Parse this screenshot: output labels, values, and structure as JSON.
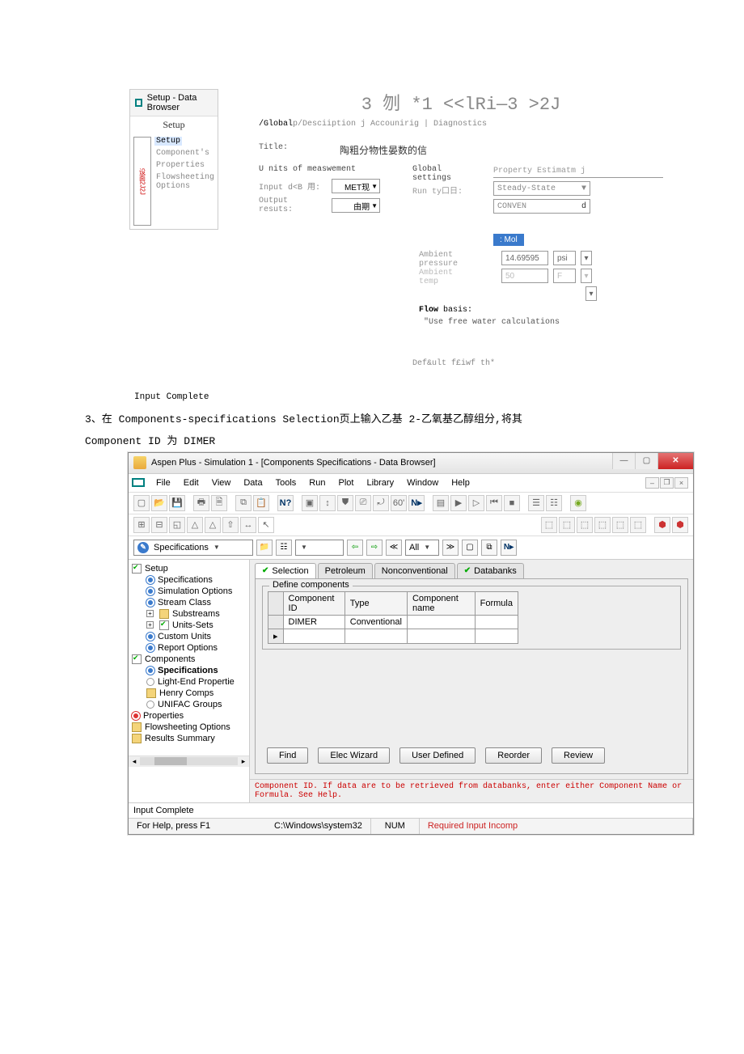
{
  "mini": {
    "title": "Setup - Data Browser",
    "subtitle": "Setup",
    "left_label": "设面2J2J",
    "items": [
      "Setup",
      "Component's",
      "Properties",
      "Flowsheeting Options"
    ]
  },
  "top": {
    "heading": "3 刎 *1 <<lRi—3 >2J",
    "tabs_prefix": "/Global",
    "tabs_rest": "p/Desciiption j Accounirig | Diagnostics",
    "title_label": "Title:",
    "title_value": "陶粗分物性晏数的信",
    "units_head": "U nits of measwement",
    "input_data_label": "Input d<B 用:",
    "input_data_value": "MET现",
    "output_label": "Output resuts:",
    "output_value": "由期",
    "global_head": "Global settings",
    "run_type_label": "Run ty口日:",
    "prop_est": "Property Estimatm j",
    "steady": "Steady-State",
    "conven": "CONVEN",
    "stream_class_tail": "d",
    "mole": ": Mol",
    "amb_press_label": "Ambient pressure",
    "amb_press_val": "14.69595",
    "amb_press_unit": "psi",
    "amb_temp_label": "Ambient temp",
    "amb_temp_val": "50",
    "amb_temp_unit": "F",
    "flow_basis": "Flow",
    "flow_basis_rest": " basis:",
    "use_free": "\"Use free water calculations",
    "defkult": "Def&ult f£iwf th*",
    "input_complete": "Input Complete"
  },
  "instr": {
    "line1": "3、在 Components-specifications Selection页上输入乙基 2-乙氧基乙醇组分,将其",
    "line2": "Component ID 为 DIMER"
  },
  "aspen": {
    "title": "Aspen Plus - Simulation 1 - [Components Specifications - Data Browser]",
    "menus": [
      "File",
      "Edit",
      "View",
      "Data",
      "Tools",
      "Run",
      "Plot",
      "Library",
      "Window",
      "Help"
    ],
    "spec_label": "Specifications",
    "nav_all": "All",
    "tree": {
      "setup": "Setup",
      "specifications": "Specifications",
      "sim_opts": "Simulation Options",
      "stream_class": "Stream Class",
      "substreams": "Substreams",
      "units_sets": "Units-Sets",
      "custom_units": "Custom Units",
      "report_options": "Report Options",
      "components": "Components",
      "comp_spec": "Specifications",
      "light_end": "Light-End Propertie",
      "henry": "Henry Comps",
      "unifac": "UNIFAC Groups",
      "properties": "Properties",
      "flowsheeting": "Flowsheeting Options",
      "results": "Results Summary"
    },
    "tabs": [
      "Selection",
      "Petroleum",
      "Nonconventional",
      "Databanks"
    ],
    "fieldset_title": "Define components",
    "table": {
      "headers": [
        "Component ID",
        "Type",
        "Component name",
        "Formula"
      ],
      "row": {
        "id": "DIMER",
        "type": "Conventional",
        "name": "",
        "formula": ""
      }
    },
    "buttons": [
      "Find",
      "Elec Wizard",
      "User Defined",
      "Reorder",
      "Review"
    ],
    "hint": "Component ID. If data are to be retrieved from databanks, enter either Component Name or Formula. See Help.",
    "status_input_complete": "Input Complete",
    "status_help": "For Help, press F1",
    "status_path": "C:\\Windows\\system32",
    "status_num": "NUM",
    "status_req": "Required Input Incomp"
  }
}
